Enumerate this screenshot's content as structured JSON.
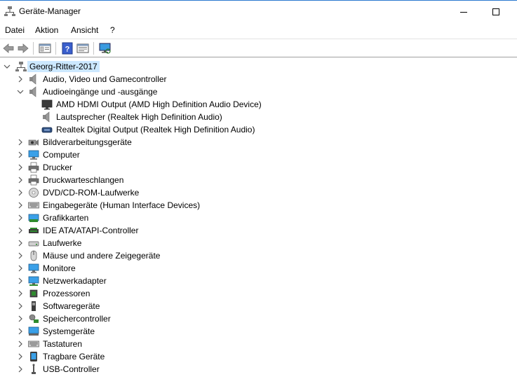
{
  "window": {
    "title": "Geräte-Manager",
    "icon": "device-manager-icon"
  },
  "menu": [
    "Datei",
    "Aktion",
    "Ansicht",
    "?"
  ],
  "toolbar": [
    "back-icon",
    "forward-icon",
    "properties-view-icon",
    "help-icon",
    "show-hidden-icon",
    "scan-hardware-icon"
  ],
  "tree": {
    "root": "Georg-Ritter-2017",
    "categories": [
      {
        "label": "Audio, Video und Gamecontroller",
        "icon": "speaker-icon",
        "expanded": false
      },
      {
        "label": "Audioeingänge und -ausgänge",
        "icon": "speaker-icon",
        "expanded": true,
        "children": [
          {
            "label": "AMD HDMI Output (AMD High Definition Audio Device)",
            "icon": "monitor-dark-icon"
          },
          {
            "label": "Lautsprecher (Realtek High Definition Audio)",
            "icon": "speaker-icon"
          },
          {
            "label": "Realtek Digital Output (Realtek High Definition Audio)",
            "icon": "digital-output-icon"
          }
        ]
      },
      {
        "label": "Bildverarbeitungsgeräte",
        "icon": "camera-icon",
        "expanded": false
      },
      {
        "label": "Computer",
        "icon": "computer-icon",
        "expanded": false
      },
      {
        "label": "Drucker",
        "icon": "printer-icon",
        "expanded": false
      },
      {
        "label": "Druckwarteschlangen",
        "icon": "printer-icon",
        "expanded": false
      },
      {
        "label": "DVD/CD-ROM-Laufwerke",
        "icon": "disc-icon",
        "expanded": false
      },
      {
        "label": "Eingabegeräte (Human Interface Devices)",
        "icon": "keyboard-icon",
        "expanded": false
      },
      {
        "label": "Grafikkarten",
        "icon": "display-adapter-icon",
        "expanded": false
      },
      {
        "label": "IDE ATA/ATAPI-Controller",
        "icon": "ide-controller-icon",
        "expanded": false
      },
      {
        "label": "Laufwerke",
        "icon": "drive-icon",
        "expanded": false
      },
      {
        "label": "Mäuse und andere Zeigegeräte",
        "icon": "mouse-icon",
        "expanded": false
      },
      {
        "label": "Monitore",
        "icon": "monitor-icon",
        "expanded": false
      },
      {
        "label": "Netzwerkadapter",
        "icon": "network-adapter-icon",
        "expanded": false
      },
      {
        "label": "Prozessoren",
        "icon": "processor-icon",
        "expanded": false
      },
      {
        "label": "Softwaregeräte",
        "icon": "software-device-icon",
        "expanded": false
      },
      {
        "label": "Speichercontroller",
        "icon": "storage-controller-icon",
        "expanded": false
      },
      {
        "label": "Systemgeräte",
        "icon": "system-device-icon",
        "expanded": false
      },
      {
        "label": "Tastaturen",
        "icon": "keyboard-icon",
        "expanded": false
      },
      {
        "label": "Tragbare Geräte",
        "icon": "portable-device-icon",
        "expanded": false
      },
      {
        "label": "USB-Controller",
        "icon": "usb-icon",
        "expanded": false
      }
    ]
  },
  "colors": {
    "selection": "#cce8ff",
    "title_border": "#2b79d0",
    "toolbar_border": "#a0a0a0"
  }
}
